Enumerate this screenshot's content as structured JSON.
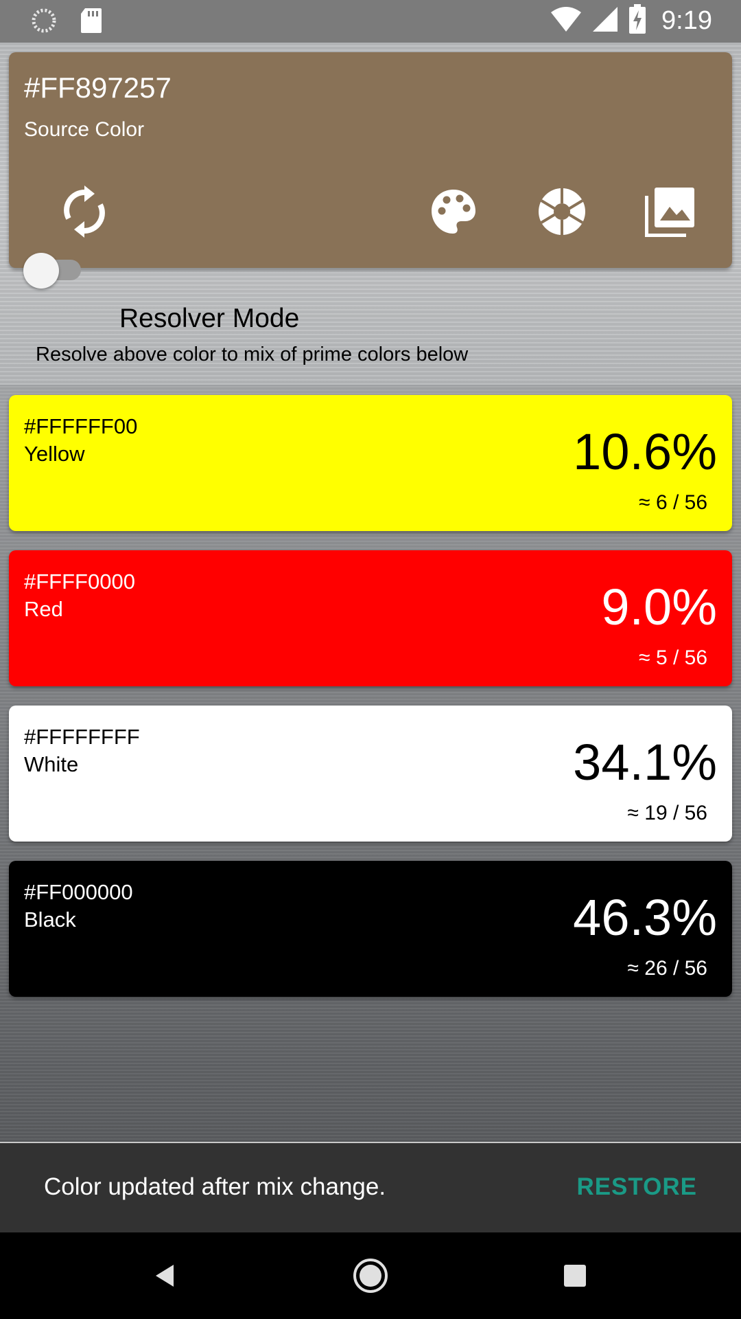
{
  "status_bar": {
    "time": "9:19",
    "left_icons": [
      "sync-spinner-icon",
      "sd-card-icon"
    ],
    "right_icons": [
      "wifi-icon",
      "cell-signal-icon",
      "battery-charging-icon"
    ]
  },
  "source": {
    "hex": "#FF897257",
    "label": "Source Color",
    "color": "#897257",
    "icons": [
      "refresh-icon",
      "palette-icon",
      "camera-shutter-icon",
      "gallery-icon"
    ]
  },
  "resolver": {
    "title": "Resolver Mode",
    "enabled": false,
    "description": "Resolve above color to mix of prime colors below"
  },
  "swatches": [
    {
      "hex": "#FFFFFF00",
      "name": "Yellow",
      "percent": "10.6%",
      "ratio": "≈ 6 / 56",
      "bg": "#ffff00",
      "fg": "#000000"
    },
    {
      "hex": "#FFFF0000",
      "name": "Red",
      "percent": "9.0%",
      "ratio": "≈ 5 / 56",
      "bg": "#ff0000",
      "fg": "#ffffff"
    },
    {
      "hex": "#FFFFFFFF",
      "name": "White",
      "percent": "34.1%",
      "ratio": "≈ 19 / 56",
      "bg": "#ffffff",
      "fg": "#000000"
    },
    {
      "hex": "#FF000000",
      "name": "Black",
      "percent": "46.3%",
      "ratio": "≈ 26 / 56",
      "bg": "#000000",
      "fg": "#ffffff"
    }
  ],
  "snackbar": {
    "message": "Color updated after mix change.",
    "action": "RESTORE",
    "action_color": "#1a9a86"
  },
  "nav": {
    "icons": [
      "back-icon",
      "home-icon",
      "recents-icon"
    ]
  }
}
